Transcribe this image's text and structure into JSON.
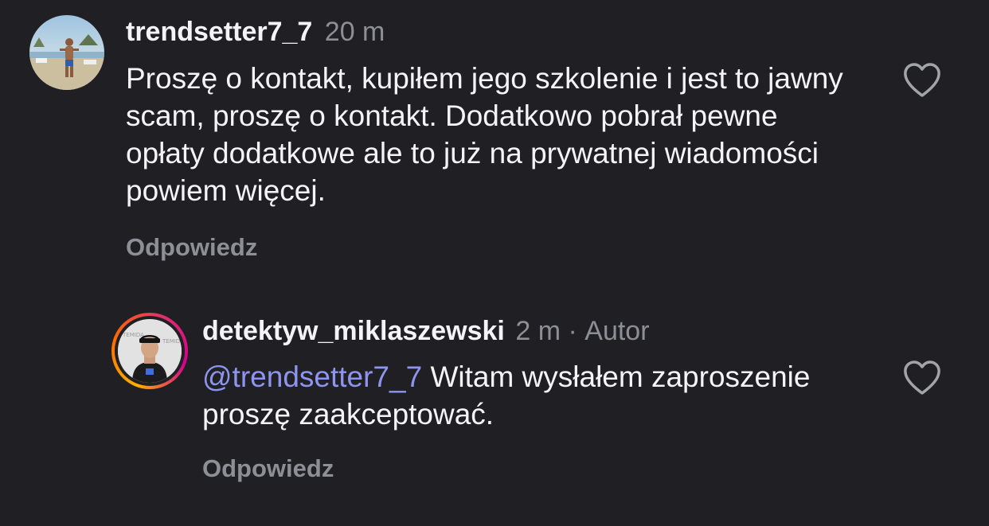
{
  "comments": [
    {
      "username": "trendsetter7_7",
      "time": "20 m",
      "text": "Proszę o kontakt, kupiłem jego szkolenie i jest to jawny scam, proszę o kontakt. Dodatkowo pobrał pewne opłaty dodatkowe ale to już na prywatnej wiadomości powiem więcej.",
      "reply_label": "Odpowiedz",
      "like_icon": "heart-outline-icon"
    },
    {
      "username": "detektyw_miklaszewski",
      "time": "2 m",
      "separator": "·",
      "author_badge": "Autor",
      "mention": "@trendsetter7_7",
      "text": "Witam wysłałem zaproszenie proszę zaakceptować.",
      "reply_label": "Odpowiedz",
      "like_icon": "heart-outline-icon",
      "avatar_logo_text": "TEMIDA"
    }
  ],
  "colors": {
    "background": "#1f1f24",
    "text": "#f4f4f6",
    "muted": "#8e8e96",
    "mention": "#8e95ee",
    "story_ring_start": "#f9b100",
    "story_ring_end": "#d3008f"
  }
}
